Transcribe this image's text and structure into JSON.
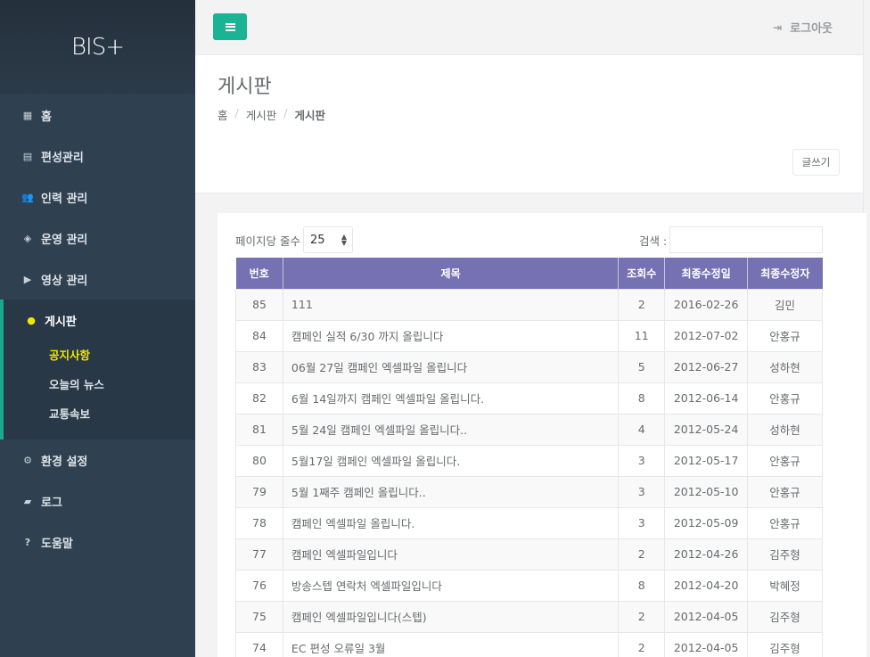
{
  "app": {
    "logo": "BIS+"
  },
  "sidebar": {
    "items": [
      {
        "label": "홈",
        "icon": "th-large-icon",
        "glyph": "▦"
      },
      {
        "label": "편성관리",
        "icon": "calendar-icon",
        "glyph": "▤"
      },
      {
        "label": "인력 관리",
        "icon": "users-icon",
        "glyph": "👥"
      },
      {
        "label": "운영 관리",
        "icon": "cube-icon",
        "glyph": "◈"
      },
      {
        "label": "영상 관리",
        "icon": "play-icon",
        "glyph": "▶"
      },
      {
        "label": "게시판",
        "icon": "comment-icon",
        "glyph": "●"
      },
      {
        "label": "환경 설정",
        "icon": "cogs-icon",
        "glyph": "⚙"
      },
      {
        "label": "로그",
        "icon": "book-icon",
        "glyph": "▰"
      },
      {
        "label": "도움말",
        "icon": "question-icon",
        "glyph": "?"
      }
    ],
    "sub_items": [
      {
        "label": "공지사항"
      },
      {
        "label": "오늘의 뉴스"
      },
      {
        "label": "교통속보"
      }
    ]
  },
  "topbar": {
    "logout_label": "로그아웃",
    "logout_glyph": "⇥"
  },
  "heading": {
    "title": "게시판",
    "breadcrumb": [
      "홈",
      "게시판",
      "게시판"
    ],
    "write_label": "글쓰기"
  },
  "controls": {
    "length_label": "페이지당 줄수",
    "length_value": "25",
    "search_label": "검색 :",
    "search_value": ""
  },
  "table": {
    "headers": [
      "번호",
      "제목",
      "조회수",
      "최종수정일",
      "최종수정자"
    ],
    "rows": [
      [
        "85",
        "111",
        "2",
        "2016-02-26",
        "김민"
      ],
      [
        "84",
        "캠페인 실적 6/30 까지 올립니다",
        "11",
        "2012-07-02",
        "안홍규"
      ],
      [
        "83",
        "06월 27일 캠페인 엑셀파일 올립니다",
        "5",
        "2012-06-27",
        "성하현"
      ],
      [
        "82",
        "6월 14일까지 캠페인 엑셀파일 올립니다.",
        "8",
        "2012-06-14",
        "안홍규"
      ],
      [
        "81",
        "5월 24일 캠페인 엑셀파일 올립니다..",
        "4",
        "2012-05-24",
        "성하현"
      ],
      [
        "80",
        "5월17일 캠페인 엑셀파일 올립니다.",
        "3",
        "2012-05-17",
        "안홍규"
      ],
      [
        "79",
        "5월 1째주 캠페인 올립니다..",
        "3",
        "2012-05-10",
        "안홍규"
      ],
      [
        "78",
        "캠페인 엑셀파일 올립니다.",
        "3",
        "2012-05-09",
        "안홍규"
      ],
      [
        "77",
        "캠페인 엑셀파일입니다",
        "2",
        "2012-04-26",
        "김주형"
      ],
      [
        "76",
        "방송스텝 연락처 엑셀파일입니다",
        "8",
        "2012-04-20",
        "박혜정"
      ],
      [
        "75",
        "캠페인 엑셀파일입니다(스텝)",
        "2",
        "2012-04-05",
        "김주형"
      ],
      [
        "74",
        "EC 편성 오류일 3월",
        "2",
        "2012-04-05",
        "김주형"
      ]
    ]
  }
}
